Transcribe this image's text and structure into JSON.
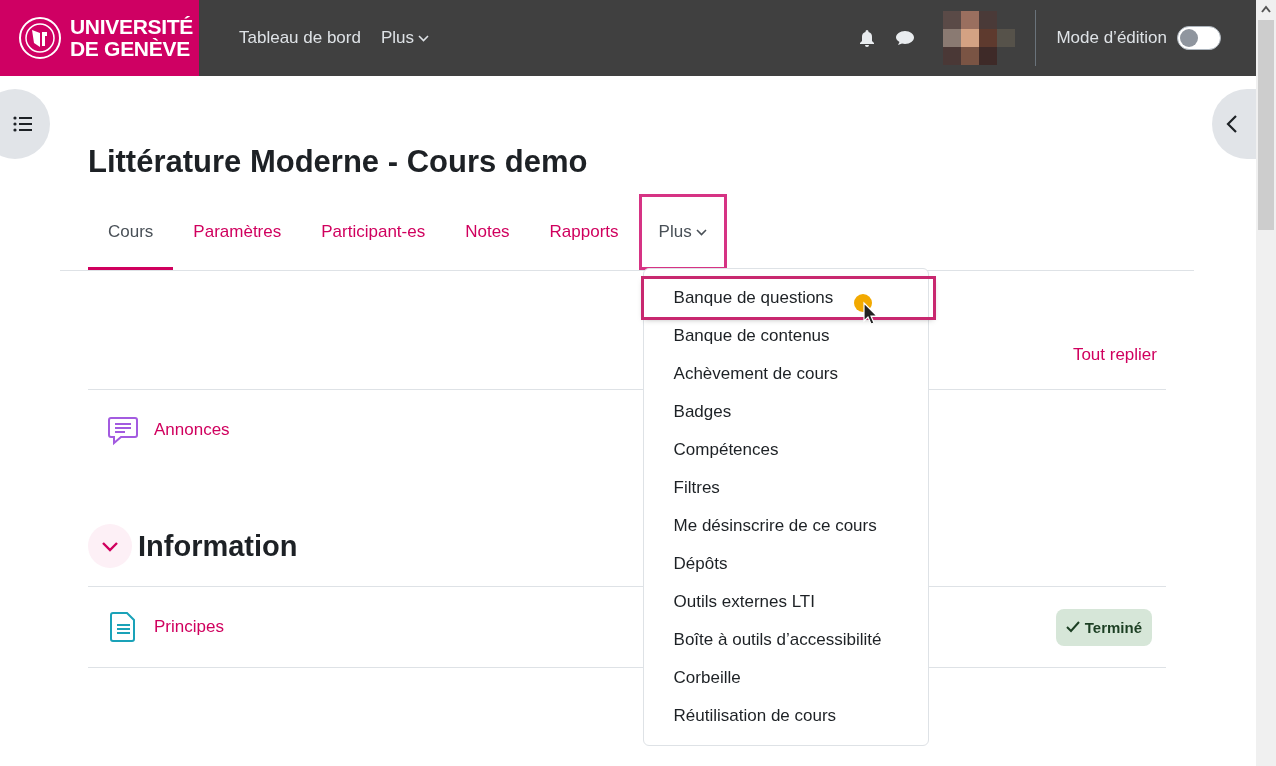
{
  "navbar": {
    "logo_lines": [
      "UNIVERSITÉ",
      "DE GENÈVE"
    ],
    "links": [
      {
        "label": "Tableau de bord",
        "dropdown": false
      },
      {
        "label": "Plus",
        "dropdown": true
      }
    ],
    "edit_mode": {
      "label": "Mode d’édition",
      "on": false
    }
  },
  "course": {
    "title": "Littérature Moderne - Cours demo",
    "tabs": [
      {
        "label": "Cours",
        "selected": true,
        "dropdown": false,
        "highlighted": false
      },
      {
        "label": "Paramètres",
        "selected": false,
        "dropdown": false,
        "highlighted": false
      },
      {
        "label": "Participant-es",
        "selected": false,
        "dropdown": false,
        "highlighted": false
      },
      {
        "label": "Notes",
        "selected": false,
        "dropdown": false,
        "highlighted": false
      },
      {
        "label": "Rapports",
        "selected": false,
        "dropdown": false,
        "highlighted": false
      },
      {
        "label": "Plus",
        "selected": false,
        "dropdown": true,
        "highlighted": true
      }
    ],
    "menu": [
      {
        "label": "Banque de questions",
        "highlighted": true
      },
      {
        "label": "Banque de contenus",
        "highlighted": false
      },
      {
        "label": "Achèvement de cours",
        "highlighted": false
      },
      {
        "label": "Badges",
        "highlighted": false
      },
      {
        "label": "Compétences",
        "highlighted": false
      },
      {
        "label": "Filtres",
        "highlighted": false
      },
      {
        "label": "Me désinscrire de ce cours",
        "highlighted": false
      },
      {
        "label": "Dépôts",
        "highlighted": false
      },
      {
        "label": "Outils externes LTI",
        "highlighted": false
      },
      {
        "label": "Boîte à outils d’accessibilité",
        "highlighted": false
      },
      {
        "label": "Corbeille",
        "highlighted": false
      },
      {
        "label": "Réutilisation de cours",
        "highlighted": false
      }
    ],
    "collapse_all": "Tout replier",
    "top_activities": [
      {
        "kind": "forum",
        "name": "Annonces"
      }
    ],
    "sections": [
      {
        "title": "Information",
        "expanded": true,
        "activities": [
          {
            "kind": "page",
            "name": "Principes",
            "status": "Terminé"
          }
        ]
      }
    ]
  }
}
